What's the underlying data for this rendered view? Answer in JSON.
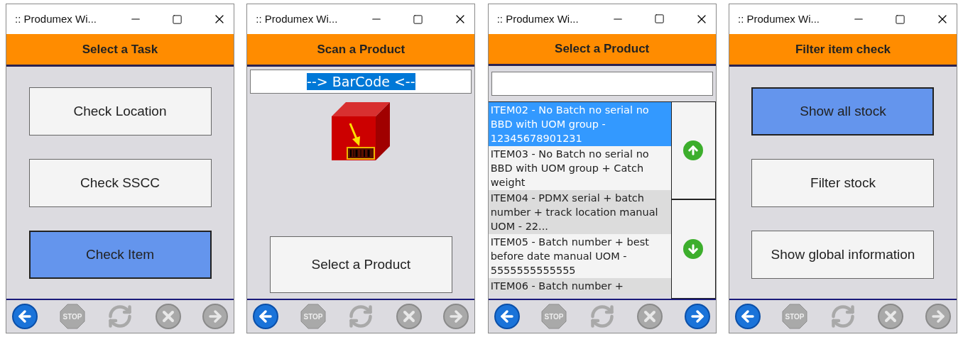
{
  "windows": [
    {
      "title": ":: Produmex Wi...",
      "header": "Select a Task",
      "kind": "buttons",
      "buttons": [
        {
          "label": "Check Location",
          "selected": false
        },
        {
          "label": "Check SSCC",
          "selected": false
        },
        {
          "label": "Check Item",
          "selected": true
        }
      ],
      "toolbar": [
        {
          "kind": "back",
          "enabled": true
        },
        {
          "kind": "stop",
          "label": "STOP",
          "enabled": false
        },
        {
          "kind": "refresh",
          "enabled": false
        },
        {
          "kind": "cancel",
          "enabled": false
        },
        {
          "kind": "next",
          "enabled": false
        }
      ]
    },
    {
      "title": ":: Produmex Wi...",
      "header": "Scan a Product",
      "kind": "scan",
      "barcode_field": {
        "value": "--> BarCode <--",
        "selected": true
      },
      "button": "Select a Product",
      "toolbar": [
        {
          "kind": "back",
          "enabled": true
        },
        {
          "kind": "stop",
          "label": "STOP",
          "enabled": false
        },
        {
          "kind": "refresh",
          "enabled": false
        },
        {
          "kind": "cancel",
          "enabled": false
        },
        {
          "kind": "next",
          "enabled": false
        }
      ]
    },
    {
      "title": ":: Produmex Wi...",
      "header": "Select a Product",
      "kind": "list",
      "items": [
        {
          "label": "ITEM02 - No Batch no serial no BBD with UOM group - 12345678901231",
          "selected": true
        },
        {
          "label": "ITEM03 - No Batch no serial no BBD with UOM group + Catch weight",
          "selected": false
        },
        {
          "label": "ITEM04 - PDMX serial + batch number + track location manual UOM - 22...",
          "selected": false
        },
        {
          "label": "ITEM05 - Batch number + best before date manual UOM - 5555555555555",
          "selected": false
        },
        {
          "label": "ITEM06 - Batch number +",
          "selected": false
        }
      ],
      "toolbar": [
        {
          "kind": "back",
          "enabled": true
        },
        {
          "kind": "stop",
          "label": "STOP",
          "enabled": false
        },
        {
          "kind": "refresh",
          "enabled": false
        },
        {
          "kind": "cancel",
          "enabled": false
        },
        {
          "kind": "next",
          "enabled": true
        }
      ]
    },
    {
      "title": ":: Produmex Wi...",
      "header": "Filter item check",
      "kind": "buttons",
      "buttons": [
        {
          "label": "Show all stock",
          "selected": true
        },
        {
          "label": "Filter stock",
          "selected": false
        },
        {
          "label": "Show global information",
          "selected": false
        }
      ],
      "toolbar": [
        {
          "kind": "back",
          "enabled": true
        },
        {
          "kind": "stop",
          "label": "STOP",
          "enabled": false
        },
        {
          "kind": "refresh",
          "enabled": false
        },
        {
          "kind": "cancel",
          "enabled": false
        },
        {
          "kind": "next",
          "enabled": false
        }
      ]
    }
  ]
}
